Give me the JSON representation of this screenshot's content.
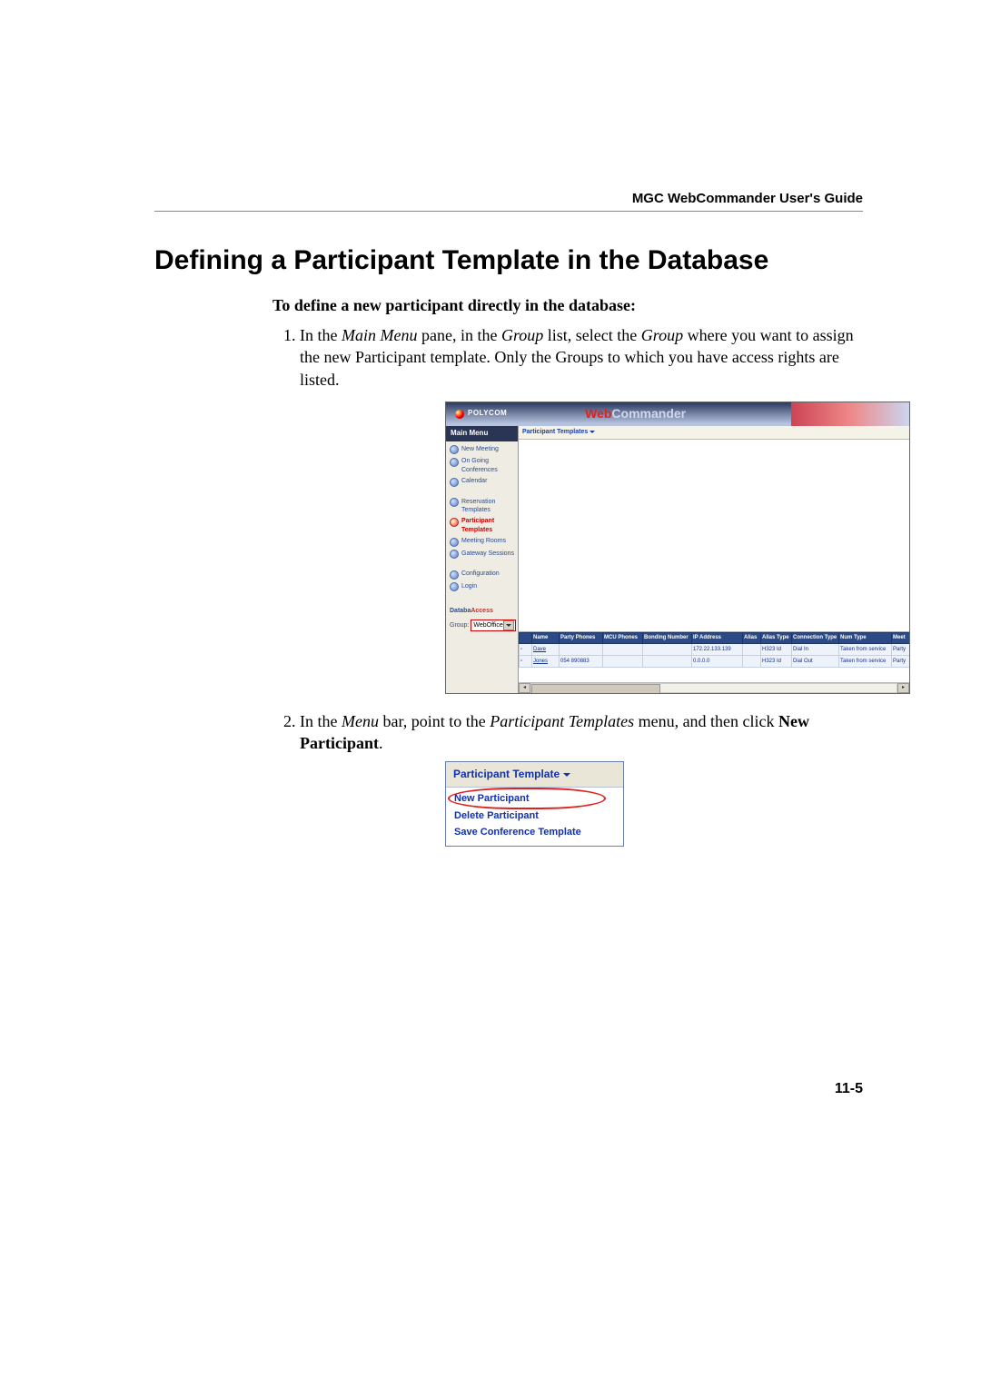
{
  "running_head": "MGC WebCommander User's Guide",
  "page_number": "11-5",
  "heading": "Defining a Participant Template in the Database",
  "lead": "To define a new participant directly in the database:",
  "step1_pre": "In the ",
  "step1_i1": "Main Menu",
  "step1_mid1": " pane, in the ",
  "step1_i2": "Group",
  "step1_mid2": " list, select the ",
  "step1_i3": "Group",
  "step1_tail": " where you want to assign the new Participant template. Only the Groups to which you have access rights are listed.",
  "step2_pre": "In the ",
  "step2_i1": "Menu",
  "step2_mid1": " bar, point to the ",
  "step2_i2": "Participant Templates",
  "step2_mid2": " menu, and then click ",
  "step2_b1": "New Participant",
  "step2_tail": ".",
  "shot1": {
    "logo_text": "POLYCOM",
    "brand_web": "Web",
    "brand_rest": "Commander",
    "main_menu_hdr": "Main Menu",
    "nav": [
      "New Meeting",
      "On Going Conferences",
      "Calendar",
      "Reservation Templates",
      "Participant Templates",
      "Meeting Rooms",
      "Gateway Sessions",
      "Configuration",
      "Login"
    ],
    "database_label_a": "Databa",
    "database_label_b": "Access",
    "group_label": "Group:",
    "group_value": "WebOffice",
    "toolbar_menu": "Participant Templates",
    "cols": [
      "",
      "Name",
      "Party Phones",
      "MCU Phones",
      "Bonding Number",
      "IP Address",
      "Alias",
      "Alias Type",
      "Connection Type",
      "Num Type",
      "Meet"
    ],
    "rows": [
      {
        "name": "Dave",
        "party": "",
        "mcu": "",
        "bond": "",
        "ip": "172.22.133.139",
        "alias": "",
        "atype": "H323 Id",
        "conn": "Dial In",
        "num": "Taken from service",
        "meet": "Party"
      },
      {
        "name": "Jones",
        "party": "054 890883",
        "mcu": "",
        "bond": "",
        "ip": "0.0.0.0",
        "alias": "",
        "atype": "H323 Id",
        "conn": "Dial Out",
        "num": "Taken from service",
        "meet": "Party"
      }
    ]
  },
  "shot2": {
    "header": "Participant Template",
    "items": [
      "New Participant",
      "Delete Participant",
      "Save Conference Template"
    ]
  }
}
